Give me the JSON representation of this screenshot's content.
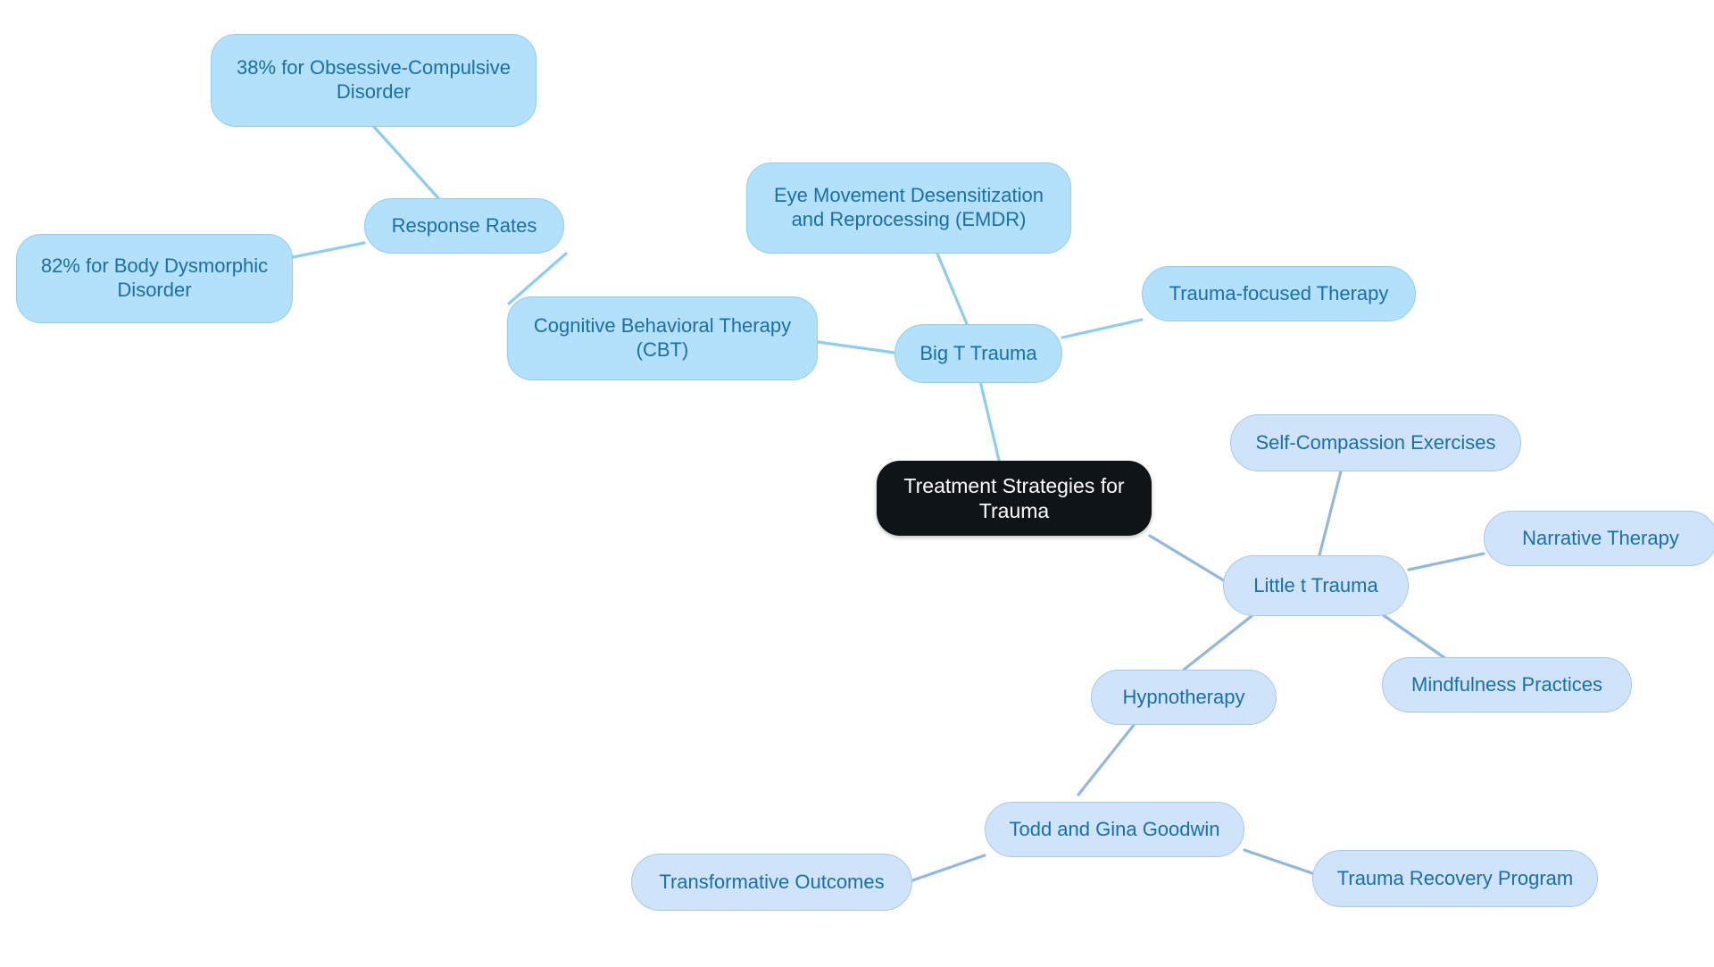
{
  "diagram": {
    "type": "mind-map",
    "title": "Treatment Strategies for Trauma",
    "background_color": "#ffffff",
    "palette": {
      "root_fill": "#0f1419",
      "root_text": "#ffffff",
      "cyan_fill": "#b3e0fa",
      "cyan_stroke": "#8ecdf0",
      "peri_fill": "#cfe3fa",
      "peri_stroke": "#a8c8e8",
      "node_text": "#1a6fa8",
      "edge_cyan": "#8ecdf0",
      "edge_peri": "#93b8db"
    }
  },
  "nodes": {
    "root": {
      "label": "Treatment Strategies for\nTrauma"
    },
    "big_t": {
      "label": "Big T Trauma"
    },
    "little_t": {
      "label": "Little t Trauma"
    },
    "cbt": {
      "label": "Cognitive Behavioral Therapy\n(CBT)"
    },
    "emdr": {
      "label": "Eye Movement Desensitization\nand Reprocessing (EMDR)"
    },
    "trauma_focused": {
      "label": "Trauma-focused Therapy"
    },
    "response_rates": {
      "label": "Response Rates"
    },
    "ocd_rate": {
      "label": "38% for Obsessive-Compulsive\nDisorder"
    },
    "bdd_rate": {
      "label": "82% for Body Dysmorphic\nDisorder"
    },
    "self_compassion": {
      "label": "Self-Compassion Exercises"
    },
    "narrative": {
      "label": "Narrative Therapy"
    },
    "mindfulness": {
      "label": "Mindfulness Practices"
    },
    "hypnotherapy": {
      "label": "Hypnotherapy"
    },
    "goodwin": {
      "label": "Todd and Gina Goodwin"
    },
    "transformative": {
      "label": "Transformative Outcomes"
    },
    "recovery_program": {
      "label": "Trauma Recovery Program"
    }
  },
  "edges": [
    {
      "from": "root",
      "to": "big_t",
      "color": "#8ecdf0"
    },
    {
      "from": "root",
      "to": "little_t",
      "color": "#93b8db"
    },
    {
      "from": "big_t",
      "to": "emdr",
      "color": "#8ecdf0"
    },
    {
      "from": "big_t",
      "to": "trauma_focused",
      "color": "#8ecdf0"
    },
    {
      "from": "big_t",
      "to": "cbt",
      "color": "#8ecdf0"
    },
    {
      "from": "cbt",
      "to": "response_rates",
      "color": "#8ecdf0"
    },
    {
      "from": "response_rates",
      "to": "ocd_rate",
      "color": "#8ecdf0"
    },
    {
      "from": "response_rates",
      "to": "bdd_rate",
      "color": "#8ecdf0"
    },
    {
      "from": "little_t",
      "to": "self_compassion",
      "color": "#93b8db"
    },
    {
      "from": "little_t",
      "to": "narrative",
      "color": "#93b8db"
    },
    {
      "from": "little_t",
      "to": "mindfulness",
      "color": "#93b8db"
    },
    {
      "from": "little_t",
      "to": "hypnotherapy",
      "color": "#93b8db"
    },
    {
      "from": "hypnotherapy",
      "to": "goodwin",
      "color": "#93b8db"
    },
    {
      "from": "goodwin",
      "to": "transformative",
      "color": "#93b8db"
    },
    {
      "from": "goodwin",
      "to": "recovery_program",
      "color": "#93b8db"
    }
  ]
}
